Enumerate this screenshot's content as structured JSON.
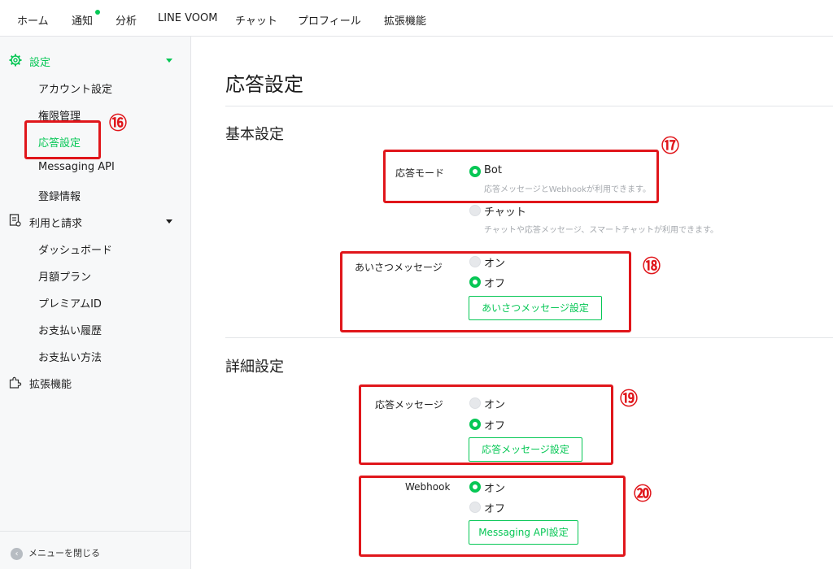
{
  "topnav": {
    "tabs": [
      "ホーム",
      "通知",
      "分析",
      "LINE VOOM",
      "チャット",
      "プロフィール",
      "拡張機能"
    ]
  },
  "sidebar": {
    "settings_label": "設定",
    "settings_items": [
      "アカウント設定",
      "権限管理",
      "応答設定",
      "Messaging API",
      "登録情報"
    ],
    "billing_label": "利用と請求",
    "billing_items": [
      "ダッシュボード",
      "月額プラン",
      "プレミアムID",
      "お支払い履歴",
      "お支払い方法"
    ],
    "extensions_label": "拡張機能",
    "close_menu": "メニューを閉じる"
  },
  "main": {
    "title": "応答設定",
    "basic": {
      "heading": "基本設定",
      "response_mode_label": "応答モード",
      "bot_label": "Bot",
      "bot_desc": "応答メッセージとWebhookが利用できます。",
      "chat_label": "チャット",
      "chat_desc": "チャットや応答メッセージ、スマートチャットが利用できます。",
      "greeting_label": "あいさつメッセージ",
      "on": "オン",
      "off": "オフ",
      "greeting_button": "あいさつメッセージ設定"
    },
    "detail": {
      "heading": "詳細設定",
      "auto_reply_label": "応答メッセージ",
      "on": "オン",
      "off": "オフ",
      "auto_reply_button": "応答メッセージ設定",
      "webhook_label": "Webhook",
      "webhook_on": "オン",
      "webhook_off": "オフ",
      "messaging_api_button": "Messaging API設定"
    }
  },
  "annotations": [
    "⑯",
    "⑰",
    "⑱",
    "⑲",
    "⑳"
  ],
  "colors": {
    "brand": "#06c755",
    "annotation": "#e0161b"
  }
}
